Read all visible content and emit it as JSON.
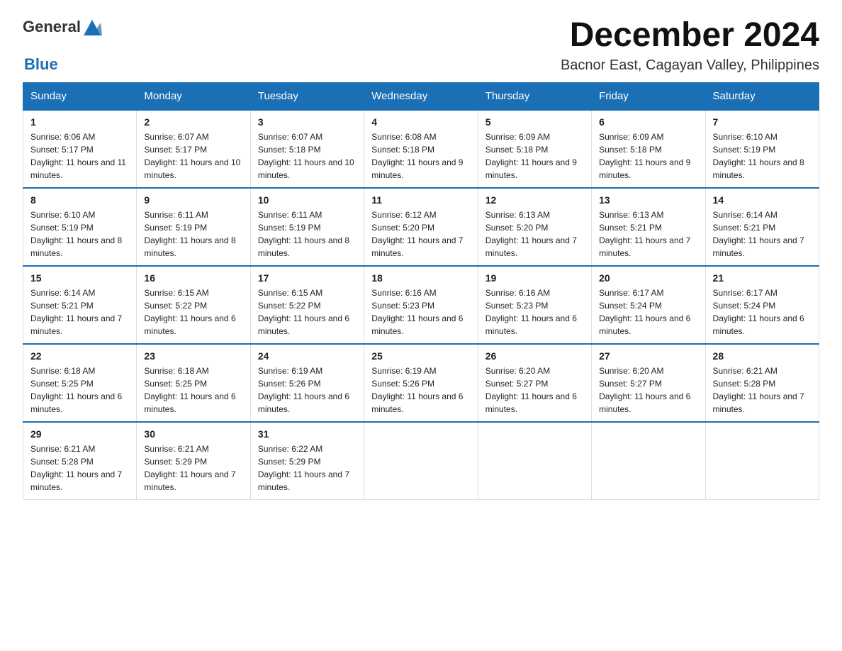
{
  "logo": {
    "text_general": "General",
    "text_blue": "Blue"
  },
  "title": "December 2024",
  "subtitle": "Bacnor East, Cagayan Valley, Philippines",
  "headers": [
    "Sunday",
    "Monday",
    "Tuesday",
    "Wednesday",
    "Thursday",
    "Friday",
    "Saturday"
  ],
  "weeks": [
    [
      {
        "day": "1",
        "sunrise": "6:06 AM",
        "sunset": "5:17 PM",
        "daylight": "11 hours and 11 minutes."
      },
      {
        "day": "2",
        "sunrise": "6:07 AM",
        "sunset": "5:17 PM",
        "daylight": "11 hours and 10 minutes."
      },
      {
        "day": "3",
        "sunrise": "6:07 AM",
        "sunset": "5:18 PM",
        "daylight": "11 hours and 10 minutes."
      },
      {
        "day": "4",
        "sunrise": "6:08 AM",
        "sunset": "5:18 PM",
        "daylight": "11 hours and 9 minutes."
      },
      {
        "day": "5",
        "sunrise": "6:09 AM",
        "sunset": "5:18 PM",
        "daylight": "11 hours and 9 minutes."
      },
      {
        "day": "6",
        "sunrise": "6:09 AM",
        "sunset": "5:18 PM",
        "daylight": "11 hours and 9 minutes."
      },
      {
        "day": "7",
        "sunrise": "6:10 AM",
        "sunset": "5:19 PM",
        "daylight": "11 hours and 8 minutes."
      }
    ],
    [
      {
        "day": "8",
        "sunrise": "6:10 AM",
        "sunset": "5:19 PM",
        "daylight": "11 hours and 8 minutes."
      },
      {
        "day": "9",
        "sunrise": "6:11 AM",
        "sunset": "5:19 PM",
        "daylight": "11 hours and 8 minutes."
      },
      {
        "day": "10",
        "sunrise": "6:11 AM",
        "sunset": "5:19 PM",
        "daylight": "11 hours and 8 minutes."
      },
      {
        "day": "11",
        "sunrise": "6:12 AM",
        "sunset": "5:20 PM",
        "daylight": "11 hours and 7 minutes."
      },
      {
        "day": "12",
        "sunrise": "6:13 AM",
        "sunset": "5:20 PM",
        "daylight": "11 hours and 7 minutes."
      },
      {
        "day": "13",
        "sunrise": "6:13 AM",
        "sunset": "5:21 PM",
        "daylight": "11 hours and 7 minutes."
      },
      {
        "day": "14",
        "sunrise": "6:14 AM",
        "sunset": "5:21 PM",
        "daylight": "11 hours and 7 minutes."
      }
    ],
    [
      {
        "day": "15",
        "sunrise": "6:14 AM",
        "sunset": "5:21 PM",
        "daylight": "11 hours and 7 minutes."
      },
      {
        "day": "16",
        "sunrise": "6:15 AM",
        "sunset": "5:22 PM",
        "daylight": "11 hours and 6 minutes."
      },
      {
        "day": "17",
        "sunrise": "6:15 AM",
        "sunset": "5:22 PM",
        "daylight": "11 hours and 6 minutes."
      },
      {
        "day": "18",
        "sunrise": "6:16 AM",
        "sunset": "5:23 PM",
        "daylight": "11 hours and 6 minutes."
      },
      {
        "day": "19",
        "sunrise": "6:16 AM",
        "sunset": "5:23 PM",
        "daylight": "11 hours and 6 minutes."
      },
      {
        "day": "20",
        "sunrise": "6:17 AM",
        "sunset": "5:24 PM",
        "daylight": "11 hours and 6 minutes."
      },
      {
        "day": "21",
        "sunrise": "6:17 AM",
        "sunset": "5:24 PM",
        "daylight": "11 hours and 6 minutes."
      }
    ],
    [
      {
        "day": "22",
        "sunrise": "6:18 AM",
        "sunset": "5:25 PM",
        "daylight": "11 hours and 6 minutes."
      },
      {
        "day": "23",
        "sunrise": "6:18 AM",
        "sunset": "5:25 PM",
        "daylight": "11 hours and 6 minutes."
      },
      {
        "day": "24",
        "sunrise": "6:19 AM",
        "sunset": "5:26 PM",
        "daylight": "11 hours and 6 minutes."
      },
      {
        "day": "25",
        "sunrise": "6:19 AM",
        "sunset": "5:26 PM",
        "daylight": "11 hours and 6 minutes."
      },
      {
        "day": "26",
        "sunrise": "6:20 AM",
        "sunset": "5:27 PM",
        "daylight": "11 hours and 6 minutes."
      },
      {
        "day": "27",
        "sunrise": "6:20 AM",
        "sunset": "5:27 PM",
        "daylight": "11 hours and 6 minutes."
      },
      {
        "day": "28",
        "sunrise": "6:21 AM",
        "sunset": "5:28 PM",
        "daylight": "11 hours and 7 minutes."
      }
    ],
    [
      {
        "day": "29",
        "sunrise": "6:21 AM",
        "sunset": "5:28 PM",
        "daylight": "11 hours and 7 minutes."
      },
      {
        "day": "30",
        "sunrise": "6:21 AM",
        "sunset": "5:29 PM",
        "daylight": "11 hours and 7 minutes."
      },
      {
        "day": "31",
        "sunrise": "6:22 AM",
        "sunset": "5:29 PM",
        "daylight": "11 hours and 7 minutes."
      },
      null,
      null,
      null,
      null
    ]
  ]
}
